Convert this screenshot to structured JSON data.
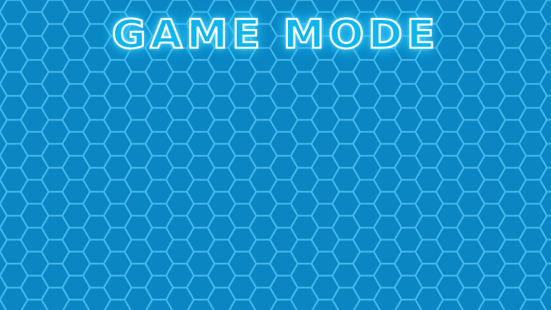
{
  "screen": {
    "title": "GAME MODE",
    "background": {
      "pattern": "hexagon-grid",
      "fill_color": "#0a86c3",
      "line_color": "#43b9ec"
    },
    "title_glow_color": "#3fd0ff"
  }
}
